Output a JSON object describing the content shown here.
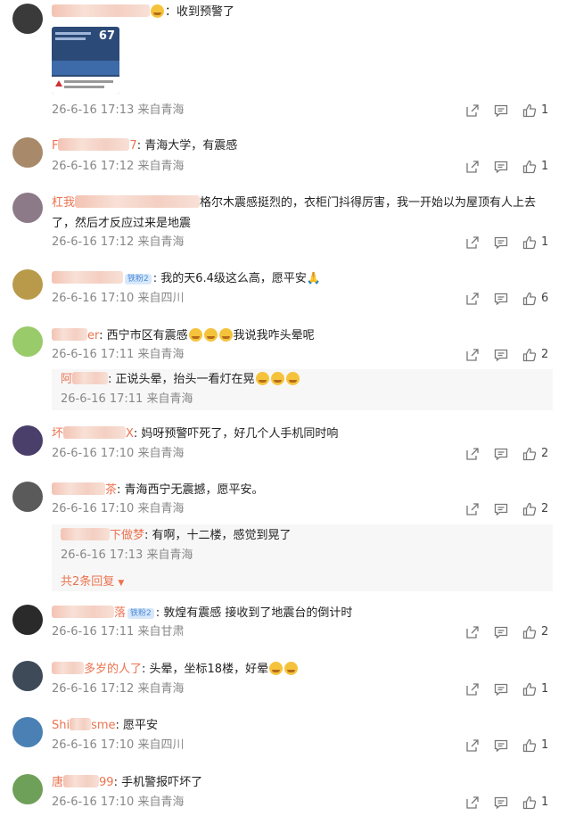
{
  "comments": [
    {
      "name_prefix": "",
      "name_suffix": "",
      "text": "：收到预警了",
      "date": "26-6-16 17:13",
      "loc": "来自青海",
      "likes": "1"
    },
    {
      "name_prefix": "F",
      "name_suffix": "7",
      "text": ": 青海大学，有震感",
      "date": "26-6-16 17:12",
      "loc": "来自青海",
      "likes": "1"
    },
    {
      "name_prefix": "杠我",
      "name_suffix": "",
      "text1": "格尔木震感挺烈的，衣柜门抖得厉害，我一开始以为屋顶有人上去",
      "text2": "了，然后才反应过来是地震",
      "date": "26-6-16 17:12",
      "loc": "来自青海",
      "likes": "1"
    },
    {
      "name_prefix": "",
      "name_suffix": "",
      "badge": "铁粉2",
      "text": ": 我的天6.4级这么高，愿平安",
      "date": "26-6-16 17:10",
      "loc": "来自四川",
      "likes": "6"
    },
    {
      "name_prefix": "",
      "name_suffix": "er",
      "text": ": 西宁市区有震感",
      "text_b": "我说我咋头晕呢",
      "date": "26-6-16 17:11",
      "loc": "来自青海",
      "likes": "2",
      "reply": {
        "name_prefix": "阿",
        "text": ": 正说头晕，抬头一看灯在晃",
        "date": "26-6-16 17:11",
        "loc": "来自青海"
      }
    },
    {
      "name_prefix": "坏",
      "name_suffix": "X",
      "text": ": 妈呀预警吓死了，好几个人手机同时响",
      "date": "26-6-16 17:10",
      "loc": "来自青海",
      "likes": "2"
    },
    {
      "name_prefix": "",
      "name_suffix": "茶",
      "text": ": 青海西宁无震撼，愿平安。",
      "date": "26-6-16 17:10",
      "loc": "来自青海",
      "likes": "2",
      "reply": {
        "name_prefix": "",
        "name_suffix": "下做梦",
        "text": ": 有啊，十二楼，感觉到晃了",
        "date": "26-6-16 17:13",
        "loc": "来自青海",
        "more": "共2条回复"
      }
    },
    {
      "name_prefix": "",
      "name_suffix": "落",
      "badge": "铁粉2",
      "text": ": 敦煌有震感 接收到了地震台的倒计时",
      "date": "26-6-16 17:11",
      "loc": "来自甘肃",
      "likes": "2"
    },
    {
      "name_prefix": "",
      "name_suffix": "多岁的人了",
      "text": ": 头晕，坐标18楼，好晕",
      "date": "26-6-16 17:12",
      "loc": "来自青海",
      "likes": "1"
    },
    {
      "name_prefix": "Shi",
      "name_suffix": "sme",
      "text": ": 愿平安",
      "date": "26-6-16 17:10",
      "loc": "来自四川",
      "likes": "1"
    },
    {
      "name_prefix": "唐",
      "name_suffix": "99",
      "text": ": 手机警报吓坏了",
      "date": "26-6-16 17:10",
      "loc": "来自青海",
      "likes": "1"
    }
  ],
  "thumb_number": "67",
  "icons": {
    "share": "share-icon",
    "comment": "comment-icon",
    "like": "like-icon"
  }
}
